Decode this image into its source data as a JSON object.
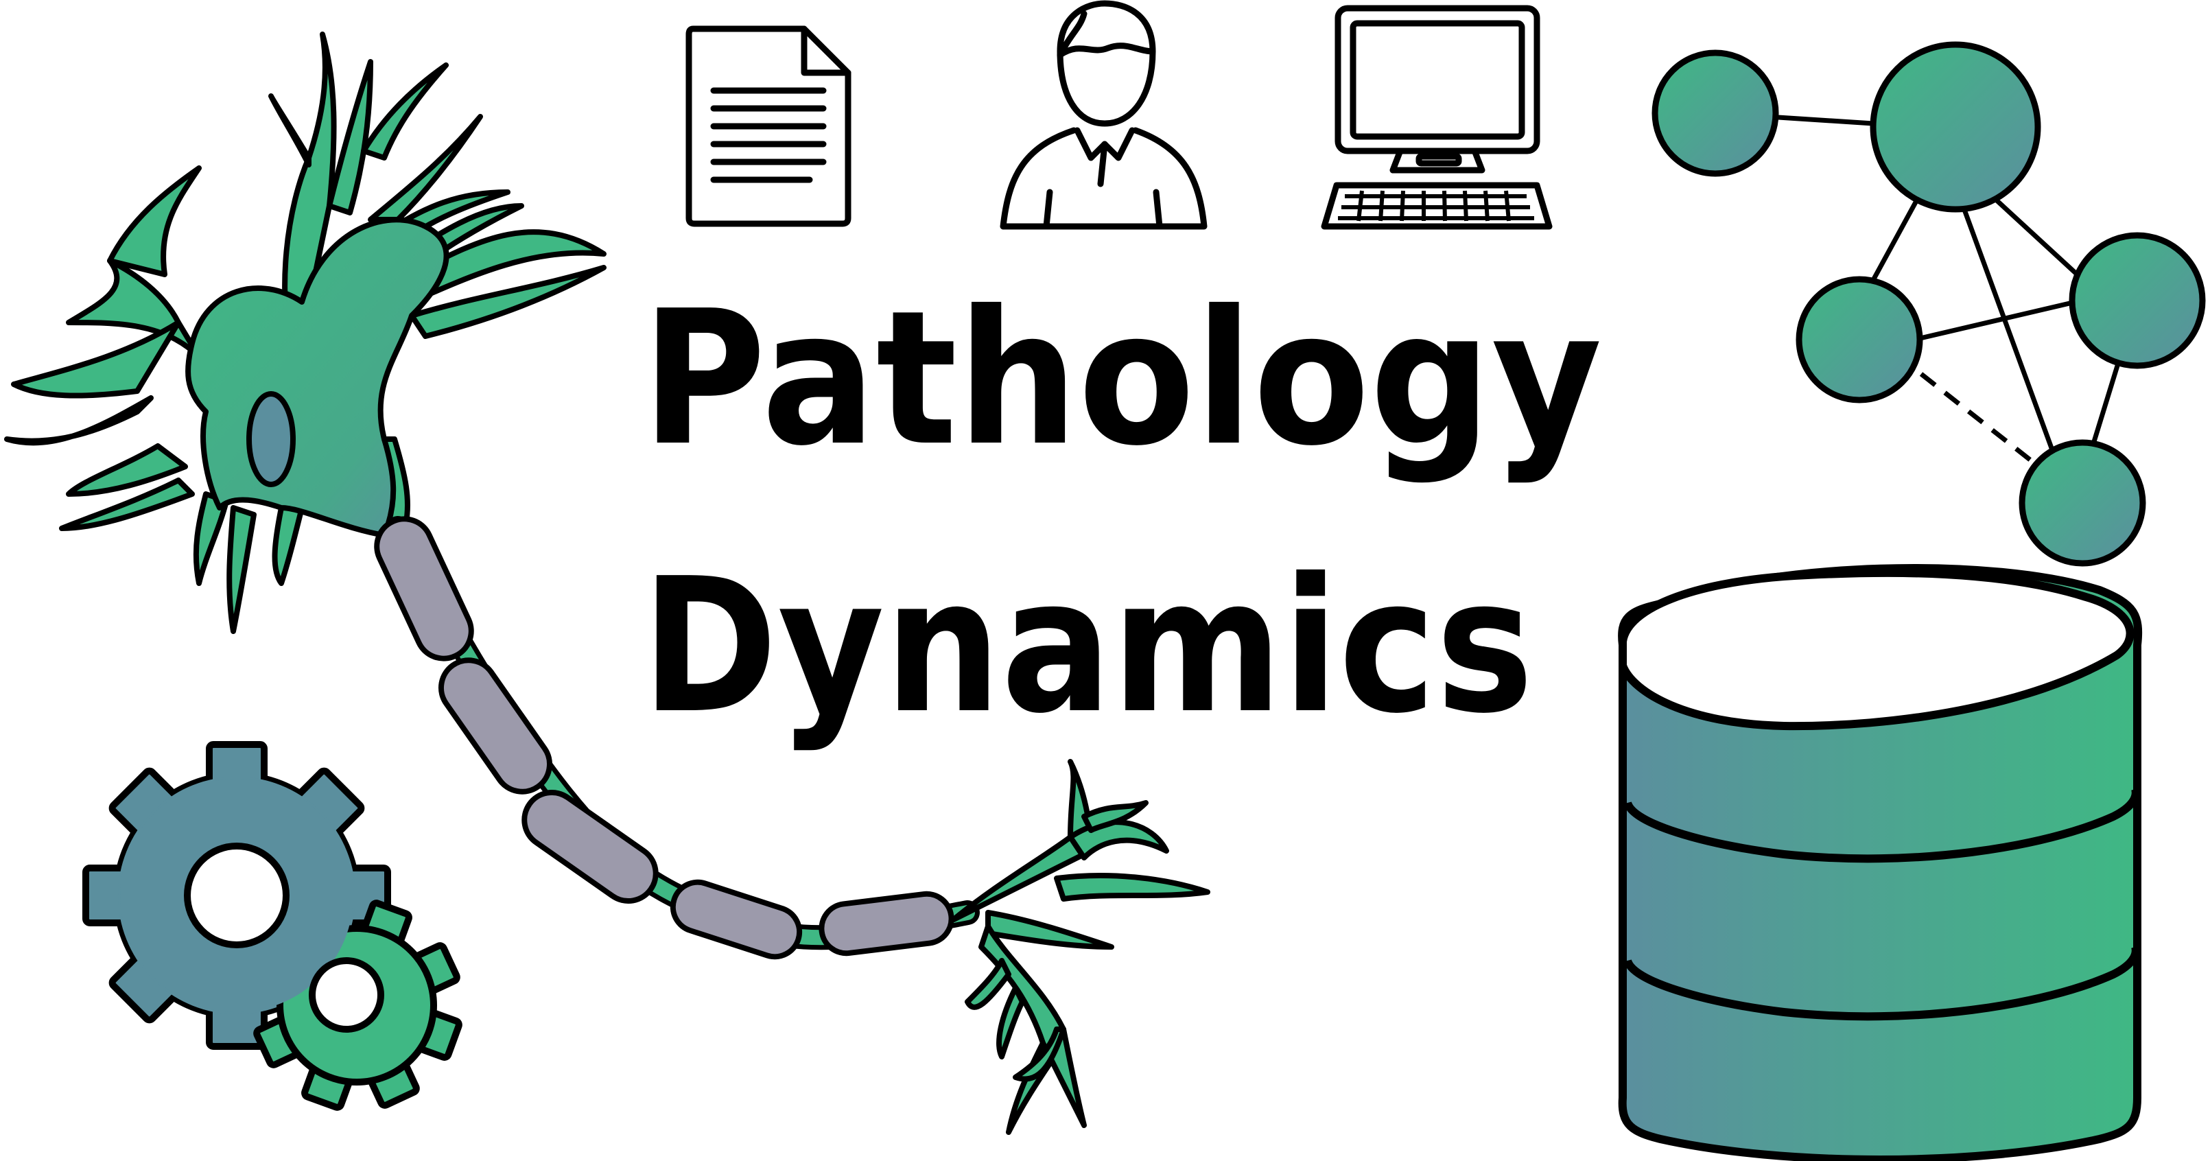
{
  "title": {
    "line1": "Pathology",
    "line2": "Dynamics"
  },
  "colors": {
    "teal_light": "#3fb884",
    "teal_dark": "#5b8f9e",
    "axon_gray": "#9c9aab",
    "outline": "#000000",
    "background": "#ffffff"
  },
  "icons": [
    "neuron-icon",
    "gear-icon",
    "document-icon",
    "person-icon",
    "computer-icon",
    "network-graph-icon",
    "database-icon"
  ]
}
